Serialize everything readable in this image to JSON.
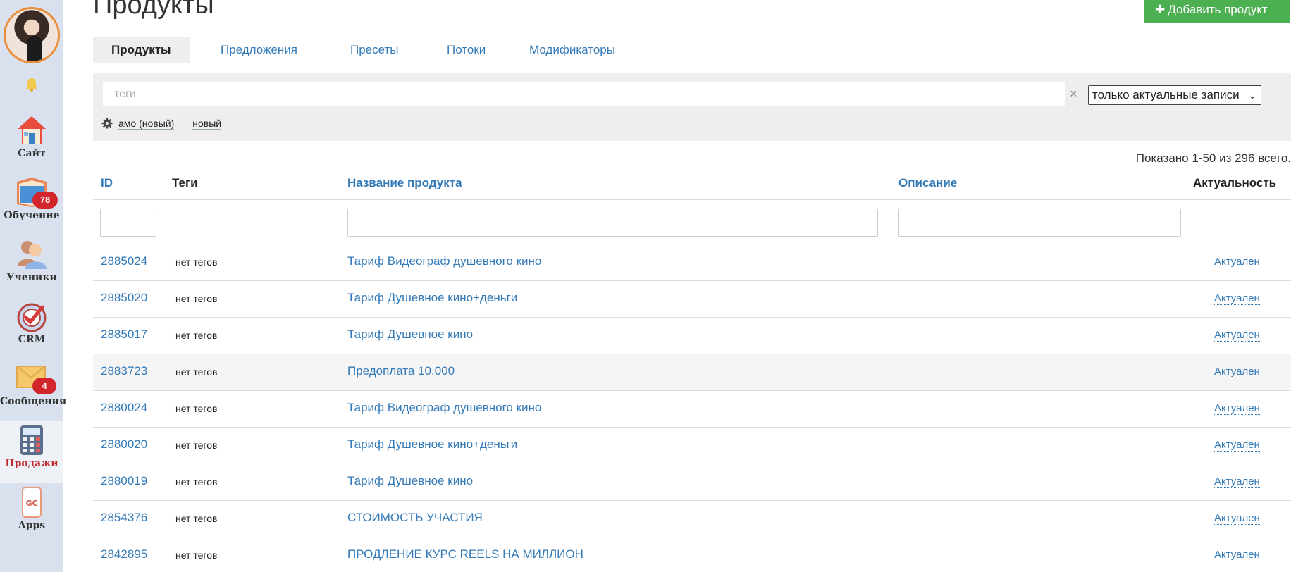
{
  "sidebar": {
    "items": [
      {
        "label": "Сайт",
        "icon": "house-icon"
      },
      {
        "label": "Обучение",
        "icon": "book-icon",
        "badge": "78"
      },
      {
        "label": "Ученики",
        "icon": "users-icon"
      },
      {
        "label": "CRM",
        "icon": "target-check-icon"
      },
      {
        "label": "Сообщения",
        "icon": "envelope-icon",
        "badge": "4"
      },
      {
        "label": "Продажи",
        "icon": "calculator-icon",
        "active": true
      },
      {
        "label": "Apps",
        "icon": "phone-gc-icon",
        "icon_text": "GC"
      }
    ]
  },
  "header": {
    "title": "Продукты",
    "add_button": "Добавить продукт"
  },
  "tabs": [
    "Продукты",
    "Предложения",
    "Пресеты",
    "Потоки",
    "Модификаторы"
  ],
  "filters": {
    "tag_placeholder": "теги",
    "clear": "×",
    "status_select": "только актуальные записи",
    "quick_tags": [
      "амо (новый)",
      "новый"
    ]
  },
  "summary": "Показано 1-50 из 296 всего.",
  "table": {
    "columns": [
      "ID",
      "Теги",
      "Название продукта",
      "Описание",
      "Актуальность"
    ],
    "rows": [
      {
        "id": "2885024",
        "tags": "нет тегов",
        "name": "Тариф Видеограф душевного кино",
        "status": "Актуален"
      },
      {
        "id": "2885020",
        "tags": "нет тегов",
        "name": "Тариф Душевное кино+деньги",
        "status": "Актуален"
      },
      {
        "id": "2885017",
        "tags": "нет тегов",
        "name": "Тариф Душевное кино",
        "status": "Актуален"
      },
      {
        "id": "2883723",
        "tags": "нет тегов",
        "name": "Предоплата 10.000",
        "status": "Актуален"
      },
      {
        "id": "2880024",
        "tags": "нет тегов",
        "name": "Тариф Видеограф душевного кино",
        "status": "Актуален"
      },
      {
        "id": "2880020",
        "tags": "нет тегов",
        "name": "Тариф Душевное кино+деньги",
        "status": "Актуален"
      },
      {
        "id": "2880019",
        "tags": "нет тегов",
        "name": "Тариф Душевное кино",
        "status": "Актуален"
      },
      {
        "id": "2854376",
        "tags": "нет тегов",
        "name": "СТОИМОСТЬ УЧАСТИЯ",
        "status": "Актуален"
      },
      {
        "id": "2842895",
        "tags": "нет тегов",
        "name": "ПРОДЛЕНИЕ КУРС REELS НА МИЛЛИОН",
        "status": "Актуален"
      }
    ]
  },
  "colors": {
    "accent": "#337ab7",
    "add_button": "#4caf50",
    "badge": "#d3262c",
    "active_nav": "#c0272d"
  }
}
